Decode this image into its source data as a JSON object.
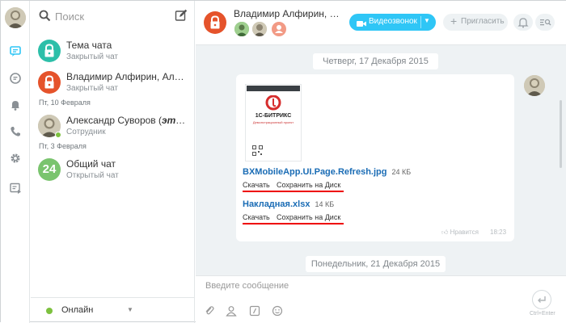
{
  "search": {
    "placeholder": "Поиск"
  },
  "recent": {
    "items": [
      {
        "title": "Тема чата",
        "subtitle": "Закрытый чат",
        "avatar": "lock-icon",
        "color": "#2dbfa9"
      },
      {
        "title": "Владимир Алфирин, Алекс...",
        "subtitle": "Закрытый чат",
        "avatar": "lock-icon",
        "color": "#e5532b"
      },
      {
        "title_plain": "Александр Суворов (",
        "title_italic": "это в...",
        "subtitle": "Сотрудник",
        "avatar": "portrait",
        "online": true
      },
      {
        "title": "Общий чат",
        "subtitle": "Открытый чат",
        "avatar_text": "24",
        "color": "#7ac46e"
      }
    ],
    "date_separators": [
      "Пт, 10 Февраля",
      "Пт, 3 Февраля"
    ]
  },
  "status": {
    "label": "Онлайн",
    "color": "#7dc13f"
  },
  "header": {
    "title": "Владимир Алфирин, Алек...",
    "video_label": "Видеозвонок",
    "invite_label": "Пригласить",
    "accent": "#2fc6f6",
    "chat_color": "#e5532b"
  },
  "messages": {
    "day1": "Четверг, 17 Декабря 2015",
    "day2": "Понедельник, 21 Декабря 2015",
    "thumb_brand": "1С-БИТРИКС",
    "thumb_sub": "Демонстрационный проект",
    "files": [
      {
        "name": "BXMobileApp.UI.Page.Refresh.jpg",
        "size": "24 КБ",
        "download": "Скачать",
        "save": "Сохранить на Диск"
      },
      {
        "name": "Накладная.xlsx",
        "size": "14 КБ",
        "download": "Скачать",
        "save": "Сохранить на Диск"
      }
    ],
    "like_label": "Нравится",
    "time": "18:23"
  },
  "composer": {
    "placeholder": "Введите сообщение",
    "send_hint": "Ctrl+Enter"
  }
}
